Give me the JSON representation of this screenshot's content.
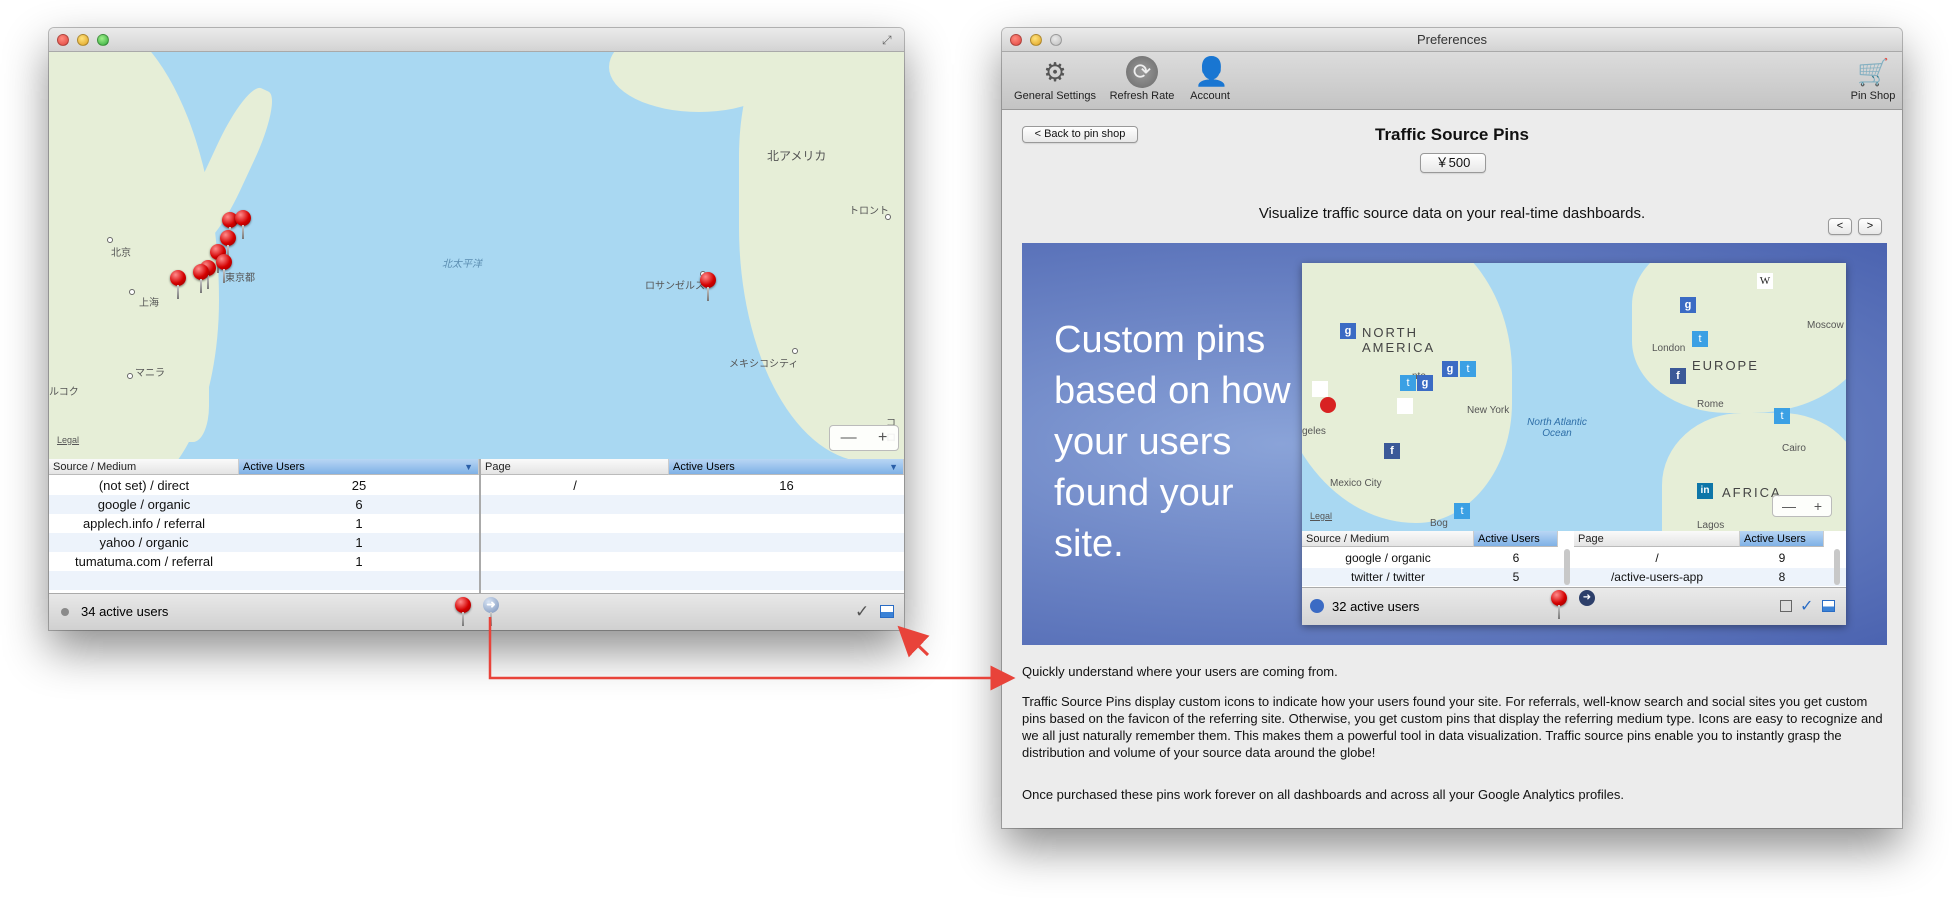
{
  "left_window": {
    "map": {
      "labels": {
        "north_america": "北アメリカ",
        "toronto": "トロント",
        "beijing": "北京",
        "tokyo": "東京都",
        "north_pacific": "北太平洋",
        "los_angeles": "ロサンゼルス",
        "shanghai": "上海",
        "manila": "マニラ",
        "mexico_city": "メキシコシティ",
        "left_edge": "ルコク",
        "right_edge": "コロ"
      },
      "legal": "Legal",
      "zoom_out": "—",
      "zoom_in": "+"
    },
    "source_table": {
      "col1": "Source / Medium",
      "col2": "Active Users",
      "rows": [
        {
          "source": "(not set) / direct",
          "users": "25"
        },
        {
          "source": "google / organic",
          "users": "6"
        },
        {
          "source": "applech.info / referral",
          "users": "1"
        },
        {
          "source": "yahoo / organic",
          "users": "1"
        },
        {
          "source": "tumatuma.com / referral",
          "users": "1"
        }
      ]
    },
    "page_table": {
      "col1": "Page",
      "col2": "Active Users",
      "rows": [
        {
          "page": "/",
          "users": "16"
        }
      ]
    },
    "status": {
      "active_users": "34 active users",
      "check": "✓"
    }
  },
  "prefs_window": {
    "title": "Preferences",
    "toolbar": {
      "general": "General Settings",
      "refresh": "Refresh Rate",
      "account": "Account",
      "pinshop": "Pin Shop"
    },
    "back_button": "< Back to pin shop",
    "product_title": "Traffic Source Pins",
    "price": "￥500",
    "tagline": "Visualize traffic source data on your real-time dashboards.",
    "prev": "<",
    "next": ">",
    "promo": {
      "headline": "Custom pins based on how your users found your site.",
      "map_labels": {
        "north_america": "NORTH AMERICA",
        "europe": "EUROPE",
        "africa": "AFRICA",
        "ocean": "North Atlantic Ocean",
        "new_york": "New York",
        "london": "London",
        "rome": "Rome",
        "cairo": "Cairo",
        "moscow": "Moscow",
        "mexico_city": "Mexico City",
        "lagos": "Lagos",
        "angeles": "geles",
        "nto": "nto",
        "bog": "Bog"
      },
      "legal": "Legal",
      "table": {
        "col1": "Source / Medium",
        "col2": "Active Users",
        "col3": "Page",
        "col4": "Active Users",
        "rows": [
          {
            "source": "google / organic",
            "users": "6",
            "page": "/",
            "page_users": "9"
          },
          {
            "source": "twitter / twitter",
            "users": "5",
            "page": "/active-users-app",
            "page_users": "8"
          }
        ]
      },
      "active_users": "32 active users"
    },
    "description": {
      "heading": "Quickly understand where your users are coming from.",
      "body": "Traffic Source Pins display custom icons to indicate how your users found your site. For referrals, well-know search and social sites you get custom pins based on the favicon of the referring site. Otherwise, you get custom pins that display the referring medium type. Icons are easy to recognize and we all just naturally remember them. This makes them a powerful tool in data visualization. Traffic source pins enable you to instantly grasp the distribution and volume of your source data around the globe!",
      "footer": "Once purchased these pins work forever on all dashboards and across all your Google Analytics profiles."
    }
  },
  "colors": {
    "pin_red": "#d40000",
    "annotation_arrow": "#e8433a",
    "promo_bg": "#5a77c0"
  }
}
